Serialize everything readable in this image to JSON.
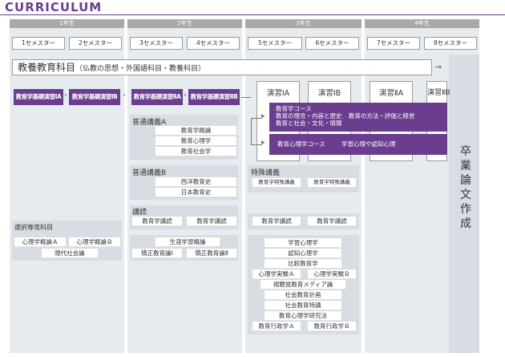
{
  "title": "CURRICULUM",
  "years": [
    "1年生",
    "2年生",
    "3年生",
    "4年生"
  ],
  "semesters": [
    "1セメスター",
    "2セメスター",
    "3セメスター",
    "4セメスター",
    "5セメスター",
    "6セメスター",
    "7セメスター",
    "8セメスター"
  ],
  "kyoyo": {
    "main": "教養教育科目",
    "sub": "（仏教の思想・外国語科目・教養科目）"
  },
  "kiso": [
    "教育学基礎演習ⅠA",
    "教育学基礎演習ⅠB",
    "教育学基礎演習ⅡA",
    "教育学基礎演習ⅡB"
  ],
  "enshu": [
    "演習ⅠA",
    "演習ⅠB",
    "演習ⅡA",
    "演習ⅡB"
  ],
  "courses": {
    "kyoikugaku_title": "教育学コース",
    "kyoikugaku_line1_a": "教育の理念・内容と歴史",
    "kyoikugaku_line1_b": "教育の方法・評価と経営",
    "kyoikugaku_line2": "教育と社会・文化・情報",
    "shinri_title": "教育心理学コース",
    "shinri_sub": "学習心理や認知心理"
  },
  "futsu_a": {
    "label": "普通講義A",
    "items": [
      "教育学概論",
      "教育心理学",
      "教育社会学"
    ]
  },
  "futsu_b": {
    "label": "普通講義B",
    "items": [
      "西洋教育史",
      "日本教育史"
    ]
  },
  "tokushu": {
    "label": "特殊講義",
    "items": [
      "教育学特殊講義",
      "教育学特殊講義"
    ]
  },
  "kodoku": {
    "label": "講読",
    "items2": [
      "教育学講読",
      "教育学講読"
    ],
    "items3": [
      "教育学講読",
      "教育学講読"
    ]
  },
  "senkyo": {
    "label": "選択専攻科目",
    "row1": [
      "心理学概論Ａ",
      "心理学概論Ｂ"
    ],
    "row2": "現代社会論"
  },
  "y2_bottom": {
    "row1": "生涯学習概論",
    "row2": [
      "矯正教育論Ⅰ",
      "矯正教育論Ⅱ"
    ]
  },
  "y3_bottom": [
    "学習心理学",
    "認知心理学",
    "比較教育学",
    "心理学実験Ａ",
    "心理学実験Ｂ",
    "視聴覚教育メディア論",
    "社会教育計画",
    "社会教育特講",
    "教育心理学研究法",
    "教育行政学Ａ",
    "教育行政学Ｂ"
  ],
  "sotsugyo": [
    "卒",
    "業",
    "論",
    "文",
    "作",
    "成"
  ]
}
